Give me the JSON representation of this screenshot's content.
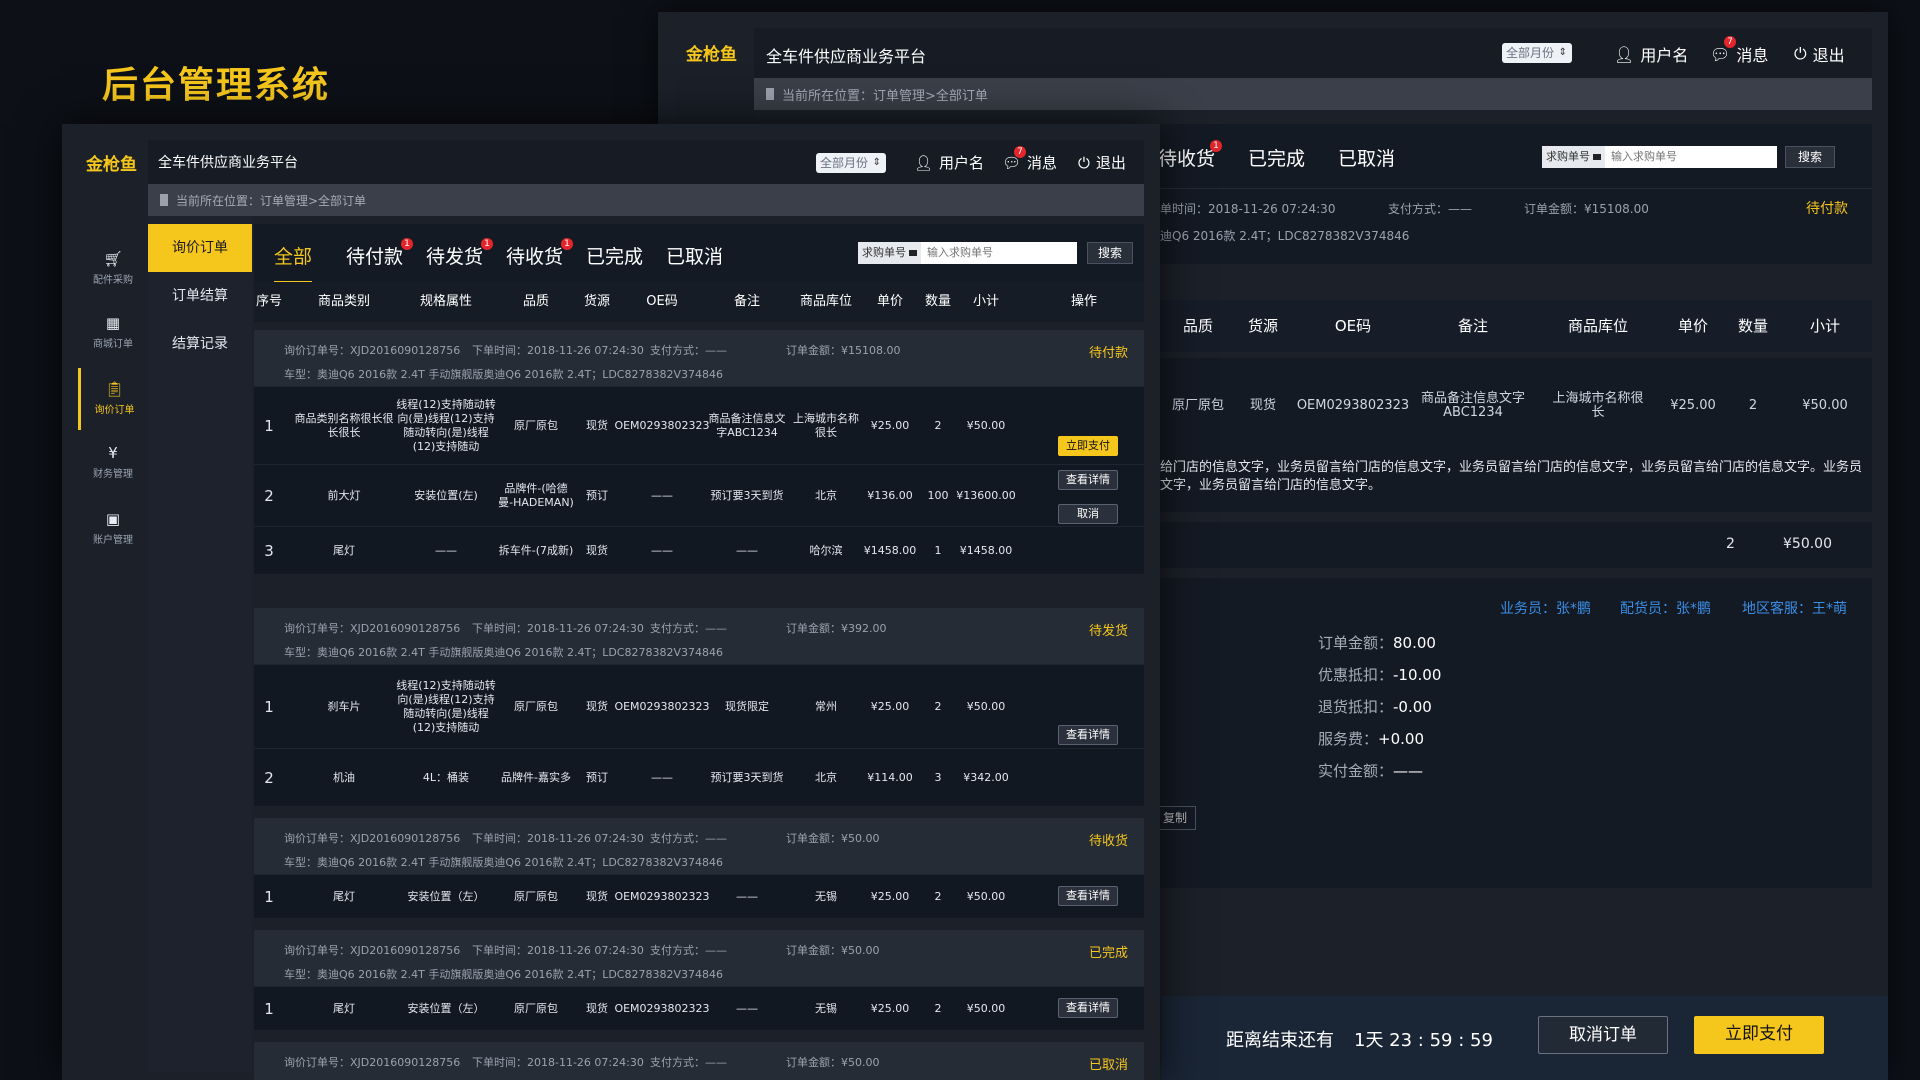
{
  "page_title": "后台管理系统",
  "header": {
    "logo": "金枪鱼",
    "platform": "全车件供应商业务平台",
    "month_select": "全部月份",
    "username": "用户名",
    "messages": "消息",
    "message_badge": "7",
    "logout": "退出"
  },
  "breadcrumb": "当前所在位置：订单管理>全部订单",
  "sidebar": {
    "icons": [
      {
        "label": "配件采购",
        "icon": "basket-icon"
      },
      {
        "label": "商城订单",
        "icon": "store-icon"
      },
      {
        "label": "询价订单",
        "icon": "clipboard-icon"
      },
      {
        "label": "财务管理",
        "icon": "yen-icon"
      },
      {
        "label": "账户管理",
        "icon": "id-card-icon"
      }
    ],
    "submenu": [
      "询价订单",
      "订单结算",
      "结算记录"
    ]
  },
  "tabs": [
    {
      "label": "全部",
      "badge": ""
    },
    {
      "label": "待付款",
      "badge": "1"
    },
    {
      "label": "待发货",
      "badge": "1"
    },
    {
      "label": "待收货",
      "badge": "1"
    },
    {
      "label": "已完成",
      "badge": ""
    },
    {
      "label": "已取消",
      "badge": ""
    }
  ],
  "search": {
    "type": "求购单号",
    "placeholder": "输入求购单号",
    "button": "搜索"
  },
  "columns": [
    "序号",
    "商品类别",
    "规格属性",
    "品质",
    "货源",
    "OE码",
    "备注",
    "商品库位",
    "单价",
    "数量",
    "小计",
    "操作"
  ],
  "orders": [
    {
      "no": "询价订单号：XJD2016090128756",
      "time": "下单时间：2018-11-26   07:24:30",
      "pay": "支付方式：——",
      "amount": "订单金额：¥15108.00",
      "status": "待付款",
      "car": "车型：奥迪Q6  2016款  2.4T  手动旗舰版奥迪Q6  2016款  2.4T；LDC8278382V374846",
      "actions": [
        "立即支付",
        "查看详情",
        "取消"
      ],
      "rows": [
        [
          "1",
          "商品类别名称很长很长很长",
          "线程(12)支持随动转向(是)线程(12)支持随动转向(是)线程(12)支持随动",
          "原厂原包",
          "现货",
          "OEM0293802323",
          "商品备注信息文字ABC1234",
          "上海城市名称很长",
          "¥25.00",
          "2",
          "¥50.00"
        ],
        [
          "2",
          "前大灯",
          "安装位置(左)",
          "品牌件-(哈德曼-HADEMAN)",
          "预订",
          "——",
          "预订要3天到货",
          "北京",
          "¥136.00",
          "100",
          "¥13600.00"
        ],
        [
          "3",
          "尾灯",
          "——",
          "拆车件-(7成新)",
          "现货",
          "——",
          "——",
          "哈尔滨",
          "¥1458.00",
          "1",
          "¥1458.00"
        ]
      ]
    },
    {
      "no": "询价订单号：XJD2016090128756",
      "time": "下单时间：2018-11-26   07:24:30",
      "pay": "支付方式：——",
      "amount": "订单金额：¥392.00",
      "status": "待发货",
      "car": "车型：奥迪Q6  2016款  2.4T  手动旗舰版奥迪Q6  2016款  2.4T；LDC8278382V374846",
      "actions": [
        "查看详情"
      ],
      "rows": [
        [
          "1",
          "刹车片",
          "线程(12)支持随动转向(是)线程(12)支持随动转向(是)线程(12)支持随动",
          "原厂原包",
          "现货",
          "OEM0293802323",
          "现货限定",
          "常州",
          "¥25.00",
          "2",
          "¥50.00"
        ],
        [
          "2",
          "机油",
          "4L：桶装",
          "品牌件-嘉实多",
          "预订",
          "——",
          "预订要3天到货",
          "北京",
          "¥114.00",
          "3",
          "¥342.00"
        ]
      ]
    },
    {
      "no": "询价订单号：XJD2016090128756",
      "time": "下单时间：2018-11-26   07:24:30",
      "pay": "支付方式：——",
      "amount": "订单金额：¥50.00",
      "status": "待收货",
      "car": "车型：奥迪Q6  2016款  2.4T  手动旗舰版奥迪Q6  2016款  2.4T；LDC8278382V374846",
      "actions": [
        "查看详情"
      ],
      "rows": [
        [
          "1",
          "尾灯",
          "安装位置（左）",
          "原厂原包",
          "现货",
          "OEM0293802323",
          "——",
          "无锡",
          "¥25.00",
          "2",
          "¥50.00"
        ]
      ]
    },
    {
      "no": "询价订单号：XJD2016090128756",
      "time": "下单时间：2018-11-26   07:24:30",
      "pay": "支付方式：——",
      "amount": "订单金额：¥50.00",
      "status": "已完成",
      "car": "车型：奥迪Q6  2016款  2.4T  手动旗舰版奥迪Q6  2016款  2.4T；LDC8278382V374846",
      "actions": [
        "查看详情"
      ],
      "rows": [
        [
          "1",
          "尾灯",
          "安装位置（左）",
          "原厂原包",
          "现货",
          "OEM0293802323",
          "——",
          "无锡",
          "¥25.00",
          "2",
          "¥50.00"
        ]
      ]
    },
    {
      "no": "询价订单号：XJD2016090128756",
      "time": "下单时间：2018-11-26   07:24:30",
      "pay": "支付方式：——",
      "amount": "订单金额：¥50.00",
      "status": "已取消",
      "car": "",
      "actions": [],
      "rows": []
    }
  ],
  "detail": {
    "tabs": [
      "待收货",
      "已完成",
      "已取消"
    ],
    "tab_badge": "1",
    "time": "单时间：2018-11-26   07:24:30",
    "pay": "支付方式：——",
    "amount": "订单金额：¥15108.00",
    "status": "待付款",
    "car": "迪Q6  2016款  2.4T；LDC8278382V374846",
    "columns": [
      "品质",
      "货源",
      "OE码",
      "备注",
      "商品库位",
      "单价",
      "数量",
      "小计"
    ],
    "row": [
      "原厂原包",
      "现货",
      "OEM0293802323",
      "商品备注信息文字ABC1234",
      "上海城市名称很长",
      "¥25.00",
      "2",
      "¥50.00"
    ],
    "message_line1": "给门店的信息文字，业务员留言给门店的信息文字，业务员留言给门店的信息文字，业务员留言给门店的信息文字。业务员",
    "message_line2": "文字，业务员留言给门店的信息文字。",
    "total_qty": "2",
    "total_sub": "¥50.00",
    "staff": {
      "sales": "业务员：张*鹏",
      "dispatcher": "配货员：张*鹏",
      "service": "地区客服：王*萌"
    },
    "summary": [
      {
        "label": "订单金额：",
        "value": "80.00"
      },
      {
        "label": "优惠抵扣：",
        "value": "-10.00"
      },
      {
        "label": "退货抵扣：",
        "value": "-0.00"
      },
      {
        "label": "服务费：",
        "value": "+0.00"
      },
      {
        "label": "实付金额：",
        "value": "——"
      }
    ],
    "copy_btn": "复制",
    "countdown_label": "距离结束还有",
    "countdown": "1天 23 : 59 : 59",
    "cancel_btn": "取消订单",
    "pay_btn": "立即支付"
  },
  "colors": {
    "accent": "#f5c61c",
    "badge": "#e2262b",
    "link": "#3a8ee6"
  }
}
